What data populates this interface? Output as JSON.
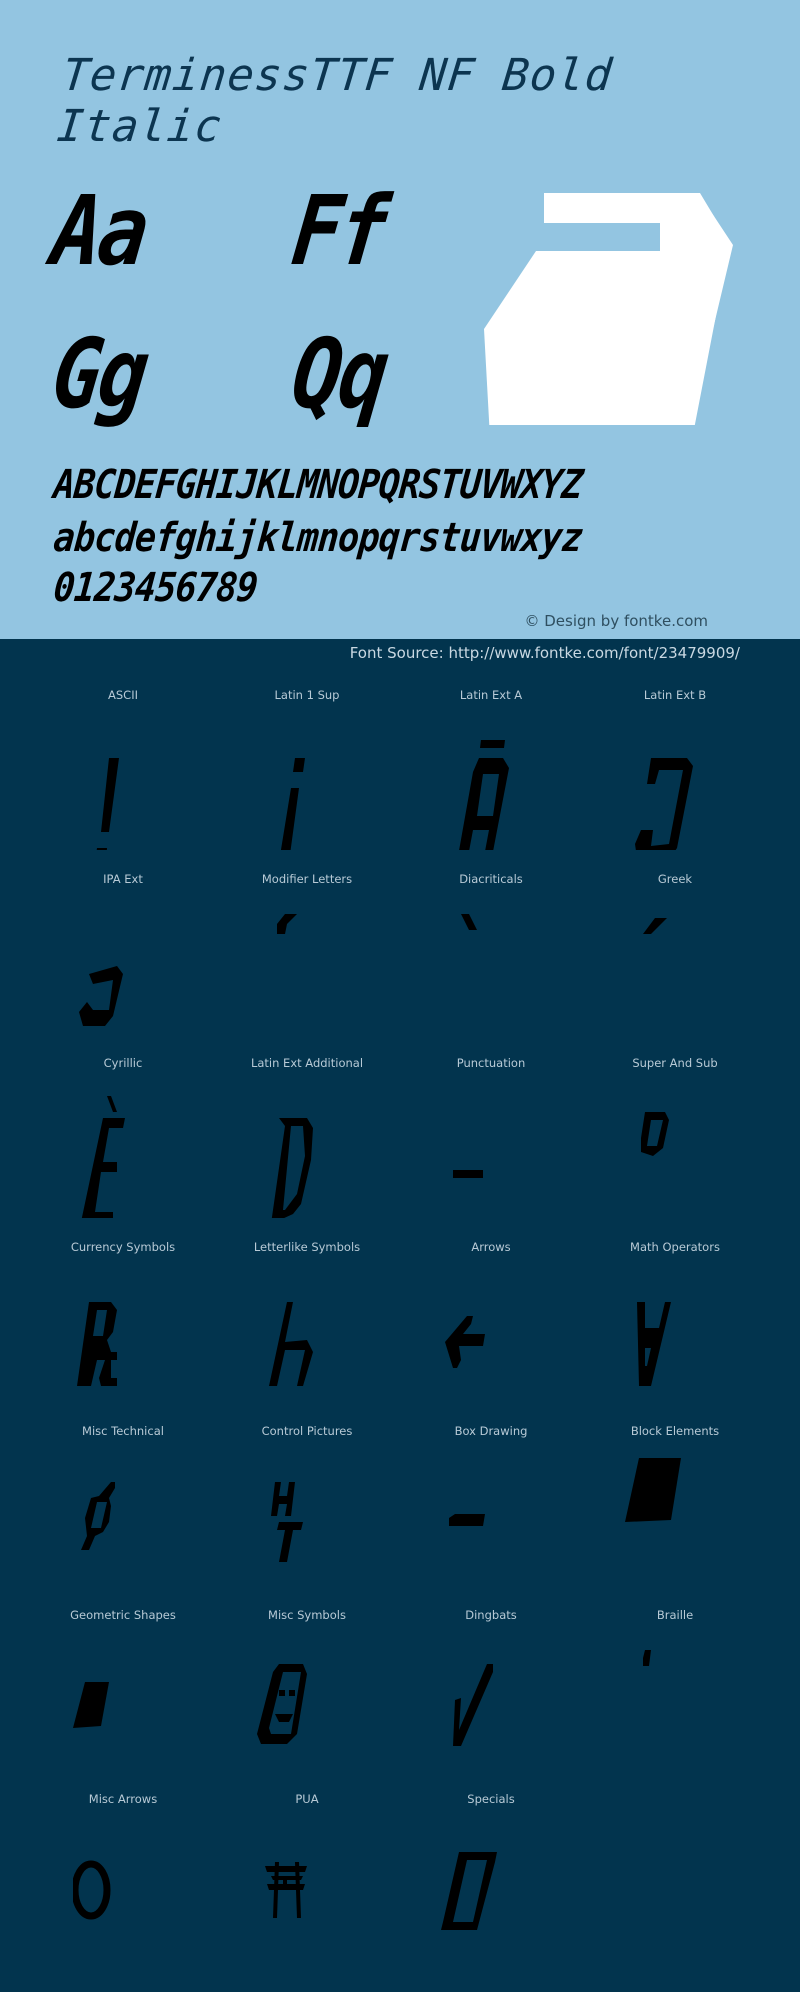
{
  "header": {
    "title": "TerminessTTF NF Bold Italic",
    "sample_pairs": [
      "Aa",
      "Ff",
      "Gg",
      "Qq"
    ],
    "big_glyph": "a",
    "uppercase": "ABCDEFGHIJKLMNOPQRSTUVWXYZ",
    "lowercase": "abcdefghijklmnopqrstuvwxyz",
    "digits": "0123456789",
    "credit": "© Design by fontke.com"
  },
  "source": "Font Source: http://www.fontke.com/font/23479909/",
  "colors": {
    "hero_bg": "#93c5e1",
    "body_bg": "#02344e",
    "title": "#0c3550",
    "glyph": "#000000",
    "big_glyph": "#ffffff"
  },
  "blocks": [
    {
      "label": "ASCII",
      "glyph": "exclamation"
    },
    {
      "label": "Latin 1 Sup",
      "glyph": "inverted-exclamation"
    },
    {
      "label": "Latin Ext A",
      "glyph": "A-macron"
    },
    {
      "label": "Latin Ext B",
      "glyph": "reversed-C"
    },
    {
      "label": "IPA Ext",
      "glyph": "open-o-reversed"
    },
    {
      "label": "Modifier Letters",
      "glyph": "modifier-comma"
    },
    {
      "label": "Diacriticals",
      "glyph": "grave-accent"
    },
    {
      "label": "Greek",
      "glyph": "tonos"
    },
    {
      "label": "Cyrillic",
      "glyph": "E-grave"
    },
    {
      "label": "Latin Ext Additional",
      "glyph": "D-dot-below"
    },
    {
      "label": "Punctuation",
      "glyph": "hyphen"
    },
    {
      "label": "Super And Sub",
      "glyph": "superscript-zero"
    },
    {
      "label": "Currency Symbols",
      "glyph": "peseta"
    },
    {
      "label": "Letterlike Symbols",
      "glyph": "planck-h"
    },
    {
      "label": "Arrows",
      "glyph": "left-arrow"
    },
    {
      "label": "Math Operators",
      "glyph": "for-all"
    },
    {
      "label": "Misc Technical",
      "glyph": "diameter"
    },
    {
      "label": "Control Pictures",
      "glyph": "symbol-HT"
    },
    {
      "label": "Box Drawing",
      "glyph": "horizontal-line"
    },
    {
      "label": "Block Elements",
      "glyph": "full-block"
    },
    {
      "label": "Geometric Shapes",
      "glyph": "black-square"
    },
    {
      "label": "Misc Symbols",
      "glyph": "smiley"
    },
    {
      "label": "Dingbats",
      "glyph": "check-mark"
    },
    {
      "label": "Braille",
      "glyph": "braille-dot"
    },
    {
      "label": "Misc Arrows",
      "glyph": "circle"
    },
    {
      "label": "PUA",
      "glyph": "torii-gate"
    },
    {
      "label": "Specials",
      "glyph": "replacement-box"
    }
  ]
}
